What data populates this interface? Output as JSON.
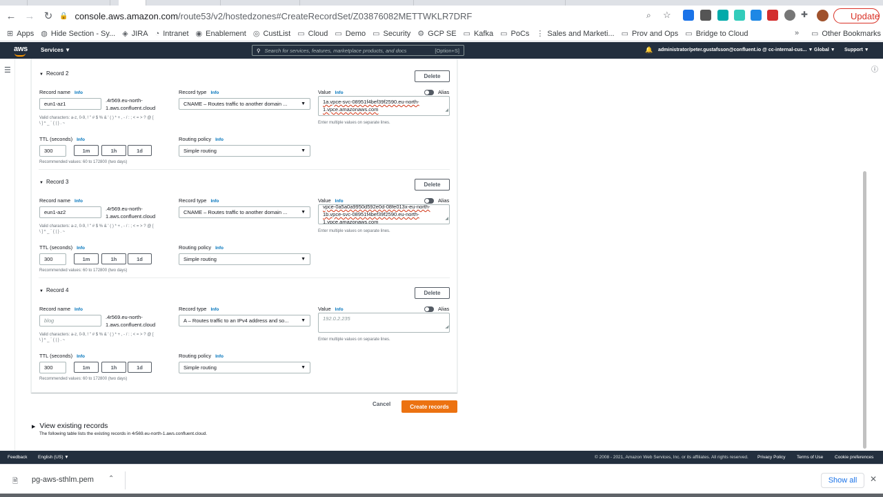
{
  "browser": {
    "url_host": "console.aws.amazon.com",
    "url_path": "/route53/v2/hostedzones#CreateRecordSet/Z03876082METTWKLR7DRF",
    "update_label": "Update"
  },
  "bookmarks": [
    {
      "label": "Apps",
      "icon": "apps-grid-icon"
    },
    {
      "label": "Hide Section - Sy...",
      "icon": "globe-icon"
    },
    {
      "label": "JIRA",
      "icon": "jira-icon"
    },
    {
      "label": "Intranet",
      "icon": "intranet-icon"
    },
    {
      "label": "Enablement",
      "icon": "enablement-icon"
    },
    {
      "label": "CustList",
      "icon": "custlist-icon"
    },
    {
      "label": "Cloud",
      "icon": "folder-icon"
    },
    {
      "label": "Demo",
      "icon": "folder-icon"
    },
    {
      "label": "Security",
      "icon": "folder-icon"
    },
    {
      "label": "GCP SE",
      "icon": "gcp-icon"
    },
    {
      "label": "Kafka",
      "icon": "folder-icon"
    },
    {
      "label": "PoCs",
      "icon": "folder-icon"
    },
    {
      "label": "Sales and Marketi...",
      "icon": "sales-icon"
    },
    {
      "label": "Prov and Ops",
      "icon": "folder-icon"
    },
    {
      "label": "Bridge to Cloud",
      "icon": "folder-icon"
    }
  ],
  "bookmarks_more": "»",
  "other_bookmarks": "Other Bookmarks",
  "aws": {
    "logo": "aws",
    "services": "Services ▼",
    "search_placeholder": "Search for services, features, marketplace products, and docs",
    "search_shortcut": "[Option+S]",
    "account": "administrator/peter.gustafsson@confluent.io @ cc-internal-cus... ▼",
    "region": "Global ▼",
    "support": "Support ▼"
  },
  "labels": {
    "record_name": "Record name",
    "record_type": "Record type",
    "value": "Value",
    "info": "Info",
    "alias": "Alias",
    "ttl": "TTL (seconds)",
    "routing_policy": "Routing policy",
    "delete": "Delete",
    "valid_chars_1": "Valid characters: a-z, 0-9, ! \" # $ % & ' ( ) * + , - / : ; < = > ? @ [",
    "valid_chars_2": "\\ ] ^ _ ` { | } . ~",
    "ttl_hint": "Recommended values: 60 to 172800 (two days)",
    "value_hint": "Enter multiple values on separate lines.",
    "btn_1m": "1m",
    "btn_1h": "1h",
    "btn_1d": "1d"
  },
  "records": [
    {
      "title": "Record 2",
      "name": "eun1-az1",
      "suffix_1": ".4r569.eu-north-",
      "suffix_2": "1.aws.confluent.cloud",
      "type": "CNAME – Routes traffic to another domain ...",
      "value_lines": [
        "1a.vpce-svc-08951f4bef39f2590.eu-north-",
        "1.vpce.amazonaws.com"
      ],
      "ttl": "300",
      "routing": "Simple routing"
    },
    {
      "title": "Record 3",
      "name": "eun1-az2",
      "suffix_1": ".4r569.eu-north-",
      "suffix_2": "1.aws.confluent.cloud",
      "type": "CNAME – Routes traffic to another domain ...",
      "value_lines": [
        "vpce-0a5a0a9950d592e0d-08fe013x-eu-north-",
        "1b.vpce-svc-08951f4bef39f2590.eu-north-",
        "1.vpce.amazonaws.com"
      ],
      "ttl": "300",
      "routing": "Simple routing"
    },
    {
      "title": "Record 4",
      "name_placeholder": "blog",
      "suffix_1": ".4r569.eu-north-",
      "suffix_2": "1.aws.confluent.cloud",
      "type": "A – Routes traffic to an IPv4 address and so...",
      "value_placeholder": "192.0.2.235",
      "ttl": "300",
      "routing": "Simple routing"
    }
  ],
  "actions": {
    "cancel": "Cancel",
    "create": "Create records"
  },
  "existing": {
    "title": "View existing records",
    "desc": "The following table lists the existing records in 4r569.eu-north-1.aws.confluent.cloud."
  },
  "footer": {
    "feedback": "Feedback",
    "language": "English (US) ▼",
    "copyright": "© 2008 - 2021, Amazon Web Services, Inc. or its affiliates. All rights reserved.",
    "privacy": "Privacy Policy",
    "terms": "Terms of Use",
    "cookies": "Cookie preferences"
  },
  "download": {
    "filename": "pg-aws-sthlm.pem",
    "show_all": "Show all"
  },
  "colors": {
    "aws_nav": "#232f3e",
    "primary_button": "#ec7211",
    "link": "#0073bb"
  }
}
